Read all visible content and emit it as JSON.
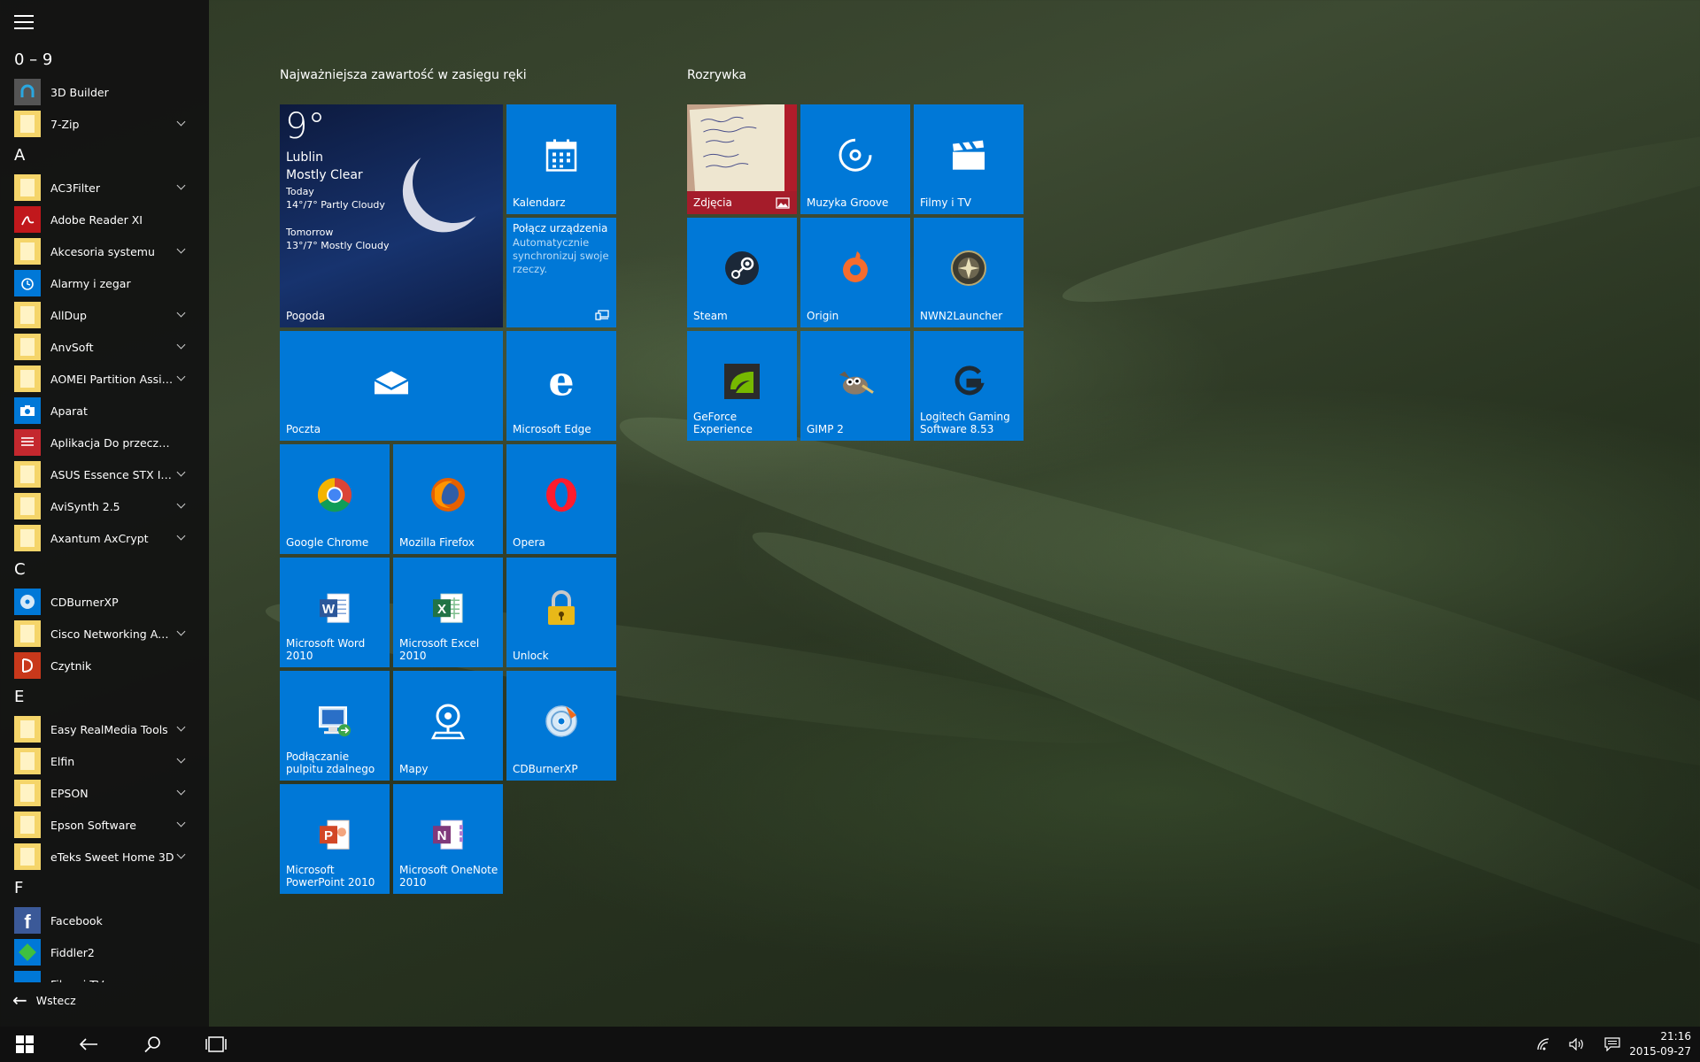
{
  "sidebar": {
    "menu_icon": "hamburger-icon",
    "groups": [
      {
        "letter": "0 – 9",
        "apps": [
          {
            "name": "3D Builder",
            "icon": "builder-icon",
            "expandable": false
          },
          {
            "name": "7-Zip",
            "icon": "folder-icon",
            "expandable": true
          }
        ]
      },
      {
        "letter": "A",
        "apps": [
          {
            "name": "AC3Filter",
            "icon": "folder-icon",
            "expandable": true
          },
          {
            "name": "Adobe Reader XI",
            "icon": "pdf-icon",
            "expandable": false
          },
          {
            "name": "Akcesoria systemu",
            "icon": "folder-icon",
            "expandable": true
          },
          {
            "name": "Alarmy i zegar",
            "icon": "alarm-icon",
            "expandable": false
          },
          {
            "name": "AllDup",
            "icon": "folder-icon",
            "expandable": true
          },
          {
            "name": "AnvSoft",
            "icon": "folder-icon",
            "expandable": true
          },
          {
            "name": "AOMEI Partition Assistan...",
            "icon": "folder-icon",
            "expandable": true
          },
          {
            "name": "Aparat",
            "icon": "camera-icon",
            "expandable": false
          },
          {
            "name": "Aplikacja Do przeczytania",
            "icon": "reading-list-icon",
            "expandable": false
          },
          {
            "name": "ASUS Essence STX II Aud...",
            "icon": "folder-icon",
            "expandable": true
          },
          {
            "name": "AviSynth 2.5",
            "icon": "folder-icon",
            "expandable": true
          },
          {
            "name": "Axantum AxCrypt",
            "icon": "folder-icon",
            "expandable": true
          }
        ]
      },
      {
        "letter": "C",
        "apps": [
          {
            "name": "CDBurnerXP",
            "icon": "disc-icon",
            "expandable": false
          },
          {
            "name": "Cisco Networking Acade...",
            "icon": "folder-icon",
            "expandable": true
          },
          {
            "name": "Czytnik",
            "icon": "reader-icon",
            "expandable": false
          }
        ]
      },
      {
        "letter": "E",
        "apps": [
          {
            "name": "Easy RealMedia Tools",
            "icon": "folder-icon",
            "expandable": true
          },
          {
            "name": "Elfin",
            "icon": "folder-icon",
            "expandable": true
          },
          {
            "name": "EPSON",
            "icon": "folder-icon",
            "expandable": true
          },
          {
            "name": "Epson Software",
            "icon": "folder-icon",
            "expandable": true
          },
          {
            "name": "eTeks Sweet Home 3D",
            "icon": "folder-icon",
            "expandable": true
          }
        ]
      },
      {
        "letter": "F",
        "apps": [
          {
            "name": "Facebook",
            "icon": "facebook-icon",
            "expandable": false
          },
          {
            "name": "Fiddler2",
            "icon": "fiddler-icon",
            "expandable": false
          },
          {
            "name": "Filmy i TV",
            "icon": "film-icon",
            "expandable": false
          }
        ]
      }
    ],
    "back_label": "Wstecz"
  },
  "tiles": {
    "group1_title": "Najważniejsza zawartość w zasięgu ręki",
    "group2_title": "Rozrywka",
    "weather": {
      "temp": "9°",
      "city": "Lublin",
      "condition": "Mostly Clear",
      "today_label": "Today",
      "today_forecast": "14°/7° Partly Cloudy",
      "tomorrow_label": "Tomorrow",
      "tomorrow_forecast": "13°/7° Mostly Cloudy",
      "app_name": "Pogoda"
    },
    "calendar": "Kalendarz",
    "connect": {
      "title": "Połącz urządzenia",
      "body": "Automatycznie synchronizuj swoje rzeczy."
    },
    "mail": "Poczta",
    "edge": "Microsoft Edge",
    "chrome": "Google Chrome",
    "firefox": "Mozilla Firefox",
    "opera": "Opera",
    "word": "Microsoft Word 2010",
    "excel": "Microsoft Excel 2010",
    "unlock": "Unlock",
    "rdp": "Podłączanie pulpitu zdalnego",
    "maps": "Mapy",
    "cdburner": "CDBurnerXP",
    "powerpoint": "Microsoft PowerPoint 2010",
    "onenote": "Microsoft OneNote 2010",
    "photos": "Zdjęcia",
    "groove": "Muzyka Groove",
    "films": "Filmy i TV",
    "steam": "Steam",
    "origin": "Origin",
    "nwn2": "NWN2Launcher",
    "geforce": "GeForce Experience",
    "gimp": "GIMP 2",
    "logitech": "Logitech Gaming Software 8.53"
  },
  "taskbar": {
    "time": "21:16",
    "date": "2015-09-27"
  },
  "colors": {
    "tile_blue": "#0078d7",
    "taskbar": "#101010",
    "sidebar": "#121212"
  }
}
